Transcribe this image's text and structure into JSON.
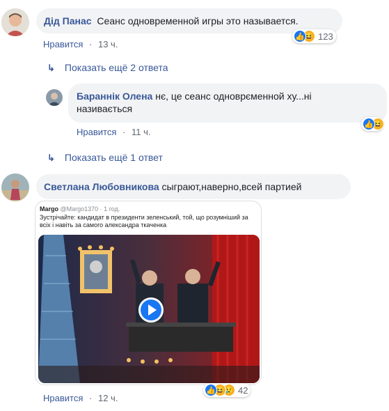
{
  "comment1": {
    "author": "Дід Панас",
    "text": "Сеанс одновременной игры это называется.",
    "like_label": "Нравится",
    "separator": "·",
    "time": "13 ч.",
    "reaction_count": "123",
    "reaction_icons": [
      "like-icon",
      "haha-icon"
    ]
  },
  "reply_link1": {
    "label": "Показать ещё 2 ответа"
  },
  "reply1": {
    "author": "Бараннік Олена",
    "text_line1": " нє, це сеанс одноврєменной ху...ні",
    "text_line2": "називається",
    "like_label": "Нравится",
    "separator": "·",
    "time": "11 ч.",
    "reaction_icons": [
      "like-icon",
      "haha-icon"
    ]
  },
  "reply_link2": {
    "label": "Показать ещё 1 ответ"
  },
  "comment2": {
    "author": "Светлана Любовникова",
    "text": " сыграют,наверно,всей партией",
    "like_label": "Нравится",
    "separator": "·",
    "time": "12 ч.",
    "reaction_count": "42",
    "reaction_icons": [
      "like-icon",
      "haha-icon",
      "sad-icon"
    ],
    "attachment": {
      "tweet_author": "Margo",
      "tweet_handle": "@Margo1370 · 1 год.",
      "tweet_text": "Зустрічайте: кандидат в президенти зеленський, той, що розумніший за всіх і навіть за самого александра ткаченка"
    }
  },
  "colors": {
    "link": "#385898",
    "bubble": "#f2f3f5",
    "like_blue": "#1877f2",
    "haha_yellow": "#f7b125",
    "play": "#1877f2"
  }
}
